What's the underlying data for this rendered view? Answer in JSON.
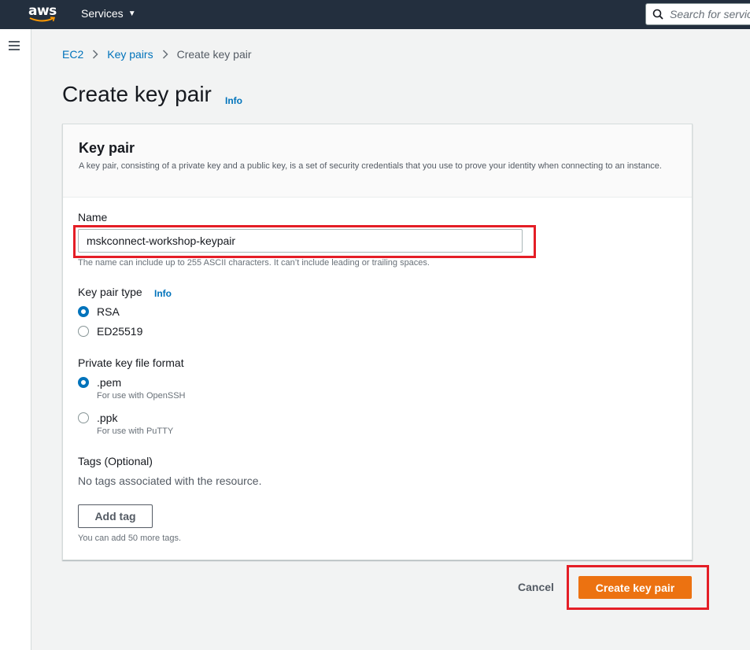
{
  "topnav": {
    "logo_text": "aws",
    "services_label": "Services",
    "search_placeholder": "Search for services"
  },
  "breadcrumb": {
    "items": [
      "EC2",
      "Key pairs"
    ],
    "current": "Create key pair"
  },
  "page": {
    "title": "Create key pair",
    "info_label": "Info"
  },
  "panel": {
    "title": "Key pair",
    "description": "A key pair, consisting of a private key and a public key, is a set of security credentials that you use to prove your identity when connecting to an instance.",
    "name": {
      "label": "Name",
      "value": "mskconnect-workshop-keypair",
      "hint": "The name can include up to 255 ASCII characters. It can’t include leading or trailing spaces."
    },
    "key_type": {
      "label": "Key pair type",
      "info_label": "Info",
      "options": [
        {
          "label": "RSA",
          "checked": true
        },
        {
          "label": "ED25519",
          "checked": false
        }
      ]
    },
    "file_format": {
      "label": "Private key file format",
      "options": [
        {
          "label": ".pem",
          "description": "For use with OpenSSH",
          "checked": true
        },
        {
          "label": ".ppk",
          "description": "For use with PuTTY",
          "checked": false
        }
      ]
    },
    "tags": {
      "label": "Tags (Optional)",
      "empty_text": "No tags associated with the resource.",
      "add_button": "Add tag",
      "hint": "You can add 50 more tags."
    }
  },
  "actions": {
    "cancel": "Cancel",
    "submit": "Create key pair"
  },
  "colors": {
    "nav_bg": "#232f3e",
    "link": "#0073bb",
    "primary_button": "#ec7211",
    "highlight_box": "#e41e26"
  }
}
